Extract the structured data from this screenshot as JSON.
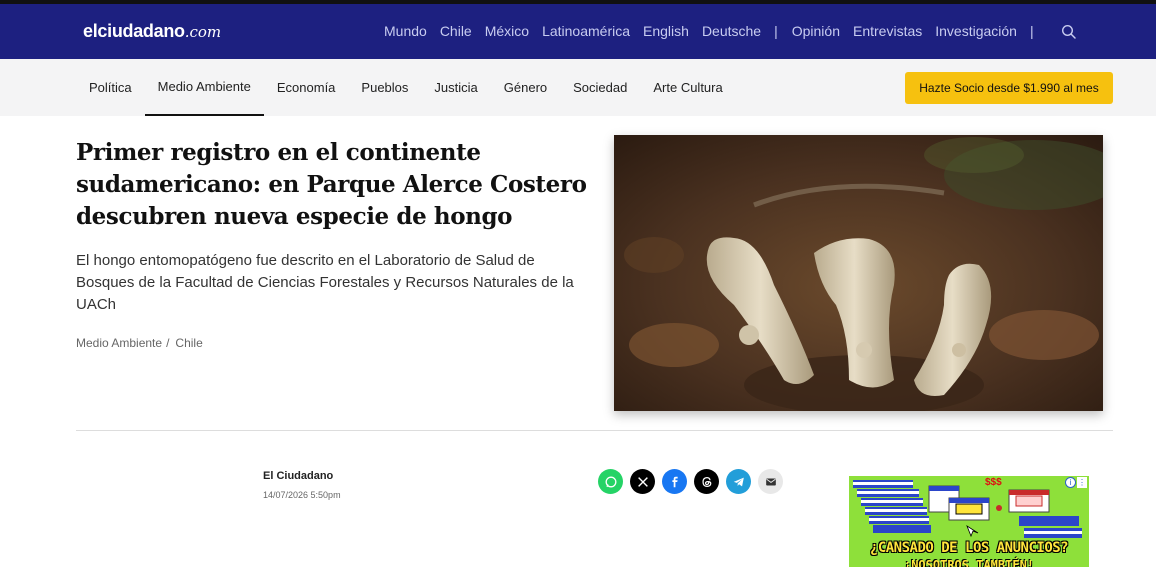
{
  "site": {
    "logo_main": "elciudadano",
    "logo_suffix": ".com"
  },
  "topnav": {
    "items": [
      "Mundo",
      "Chile",
      "México",
      "Latinoamérica",
      "English",
      "Deutsche"
    ],
    "separator": "|",
    "items2": [
      "Opinión",
      "Entrevistas",
      "Investigación"
    ],
    "search_icon": "search-icon"
  },
  "sections": {
    "items": [
      "Política",
      "Medio Ambiente",
      "Economía",
      "Pueblos",
      "Justicia",
      "Género",
      "Sociedad",
      "Arte Cultura"
    ],
    "active": "Medio Ambiente",
    "cta": "Hazte Socio desde $1.990 al mes"
  },
  "article": {
    "headline": "Primer registro en el continente sudamericano: en Parque Alerce Costero descubren nueva especie de hongo",
    "summary": "El hongo entomopatógeno fue descrito en el Laboratorio de Salud de Bosques de la Facultad de Ciencias Forestales y Recursos Naturales de la UACh",
    "categories": [
      "Medio Ambiente",
      "Chile"
    ],
    "category_separator": "/",
    "author": "El Ciudadano",
    "date": "14/07/2026 5:50pm"
  },
  "share": {
    "buttons": [
      {
        "name": "whatsapp",
        "color": "#25d366"
      },
      {
        "name": "x",
        "color": "#000000"
      },
      {
        "name": "facebook",
        "color": "#1877f2"
      },
      {
        "name": "threads",
        "color": "#000000"
      },
      {
        "name": "telegram",
        "color": "#229ed9"
      },
      {
        "name": "email",
        "color": "#e8e8e8"
      }
    ]
  },
  "ad": {
    "money": "$$$",
    "headline": "¿CANSADO DE LOS ANUNCIOS?",
    "subline": "¡NOSOTROS TAMBIÉN!"
  },
  "colors": {
    "brand": "#1d2080",
    "cta": "#f6c10f"
  }
}
